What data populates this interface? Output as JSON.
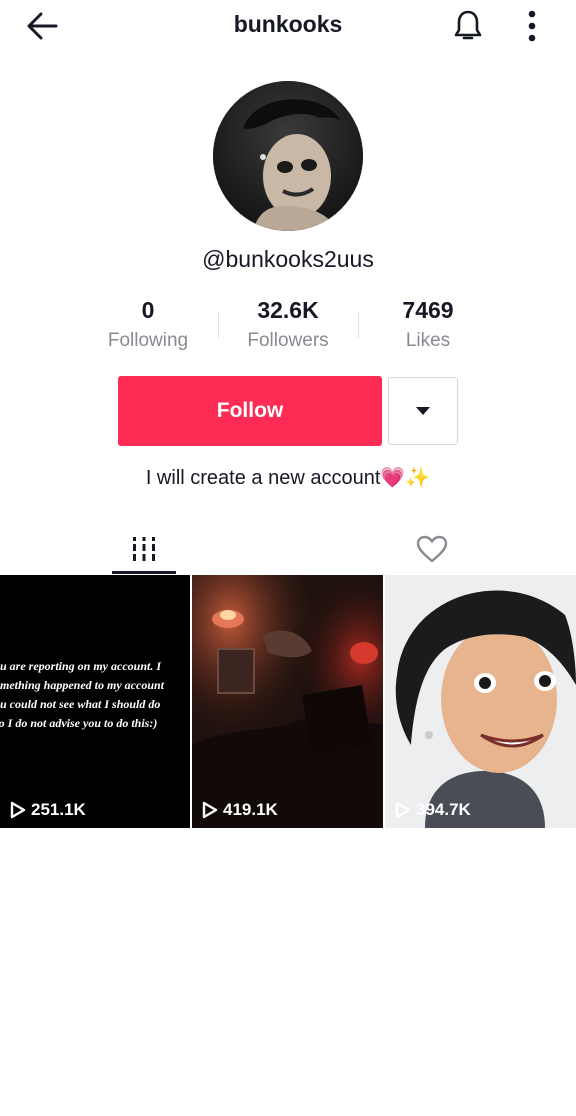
{
  "header": {
    "title": "bunkooks",
    "back_icon": "arrow-left-icon",
    "bell_icon": "bell-icon",
    "more_icon": "more-vertical-icon"
  },
  "profile": {
    "username": "@bunkooks2uus",
    "bio": "I will create a new account💗✨"
  },
  "stats": [
    {
      "value": "0",
      "label": "Following"
    },
    {
      "value": "32.6K",
      "label": "Followers"
    },
    {
      "value": "7469",
      "label": "Likes"
    }
  ],
  "actions": {
    "follow_label": "Follow",
    "dropdown_icon": "caret-down-icon"
  },
  "tabs": [
    {
      "icon": "videos-grid-icon",
      "active": true
    },
    {
      "icon": "heart-outline-icon",
      "active": false
    }
  ],
  "videos": [
    {
      "views": "251.1K",
      "caption_lines": [
        "ou are reporting on my account. I",
        "omething happened to my account",
        "ou could not see what I should do",
        "so I do not advise you to do this:)"
      ]
    },
    {
      "views": "419.1K"
    },
    {
      "views": "394.7K"
    }
  ],
  "colors": {
    "accent": "#fe2c55",
    "text": "#161823",
    "muted": "#8a8b91"
  }
}
